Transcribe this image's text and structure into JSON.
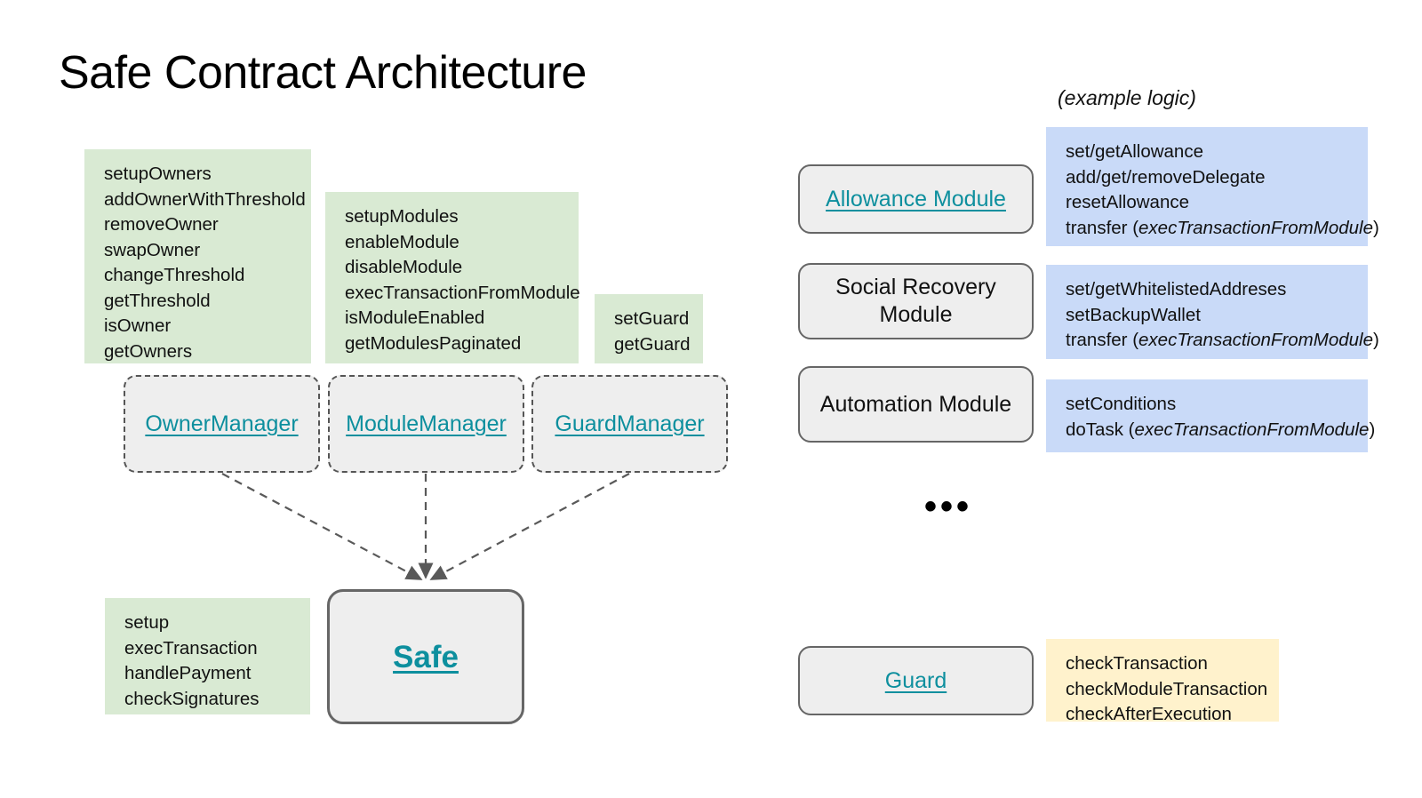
{
  "page": {
    "title": "Safe Contract Architecture",
    "example_logic_label": "(example logic)",
    "ellipsis": "•••"
  },
  "colors": {
    "green_fill": "#d9ead3",
    "blue_fill": "#c9daf8",
    "yellow_fill": "#fff2cc",
    "node_fill": "#eeeeee",
    "node_border": "#666666",
    "dashed_border": "#555555",
    "link_teal": "#0d8f9e",
    "arrow_gray": "#595959",
    "background": "#ffffff",
    "text": "#111111"
  },
  "left": {
    "owner_manager": {
      "node_label": "OwnerManager",
      "methods": [
        "setupOwners",
        "addOwnerWithThreshold",
        "removeOwner",
        "swapOwner",
        "changeThreshold",
        "getThreshold",
        "isOwner",
        "getOwners"
      ]
    },
    "module_manager": {
      "node_label": "ModuleManager",
      "methods": [
        "setupModules",
        "enableModule",
        "disableModule",
        "execTransactionFromModule",
        "isModuleEnabled",
        "getModulesPaginated"
      ]
    },
    "guard_manager": {
      "node_label": "GuardManager",
      "methods": [
        "setGuard",
        "getGuard"
      ]
    },
    "safe": {
      "node_label": "Safe",
      "methods": [
        "setup",
        "execTransaction",
        "handlePayment",
        "checkSignatures"
      ]
    }
  },
  "right": {
    "modules": [
      {
        "name": "Allowance Module",
        "is_link": true,
        "logic": [
          {
            "text": "set/getAllowance",
            "italic_part": ""
          },
          {
            "text": "add/get/removeDelegate",
            "italic_part": ""
          },
          {
            "text": "resetAllowance",
            "italic_part": ""
          },
          {
            "text": "transfer (execTransactionFromModule)",
            "italic_part": "execTransactionFromModule"
          }
        ]
      },
      {
        "name": "Social Recovery Module",
        "is_link": false,
        "logic": [
          {
            "text": "set/getWhitelistedAddreses",
            "italic_part": ""
          },
          {
            "text": "setBackupWallet",
            "italic_part": ""
          },
          {
            "text": "transfer (execTransactionFromModule)",
            "italic_part": "execTransactionFromModule"
          }
        ]
      },
      {
        "name": "Automation Module",
        "is_link": false,
        "logic": [
          {
            "text": "setConditions",
            "italic_part": ""
          },
          {
            "text": "doTask (execTransactionFromModule)",
            "italic_part": "execTransactionFromModule"
          }
        ]
      }
    ],
    "guard": {
      "name": "Guard",
      "is_link": true,
      "logic": [
        {
          "text": "checkTransaction",
          "italic_part": ""
        },
        {
          "text": "checkModuleTransaction",
          "italic_part": ""
        },
        {
          "text": "checkAfterExecution",
          "italic_part": ""
        }
      ]
    }
  }
}
